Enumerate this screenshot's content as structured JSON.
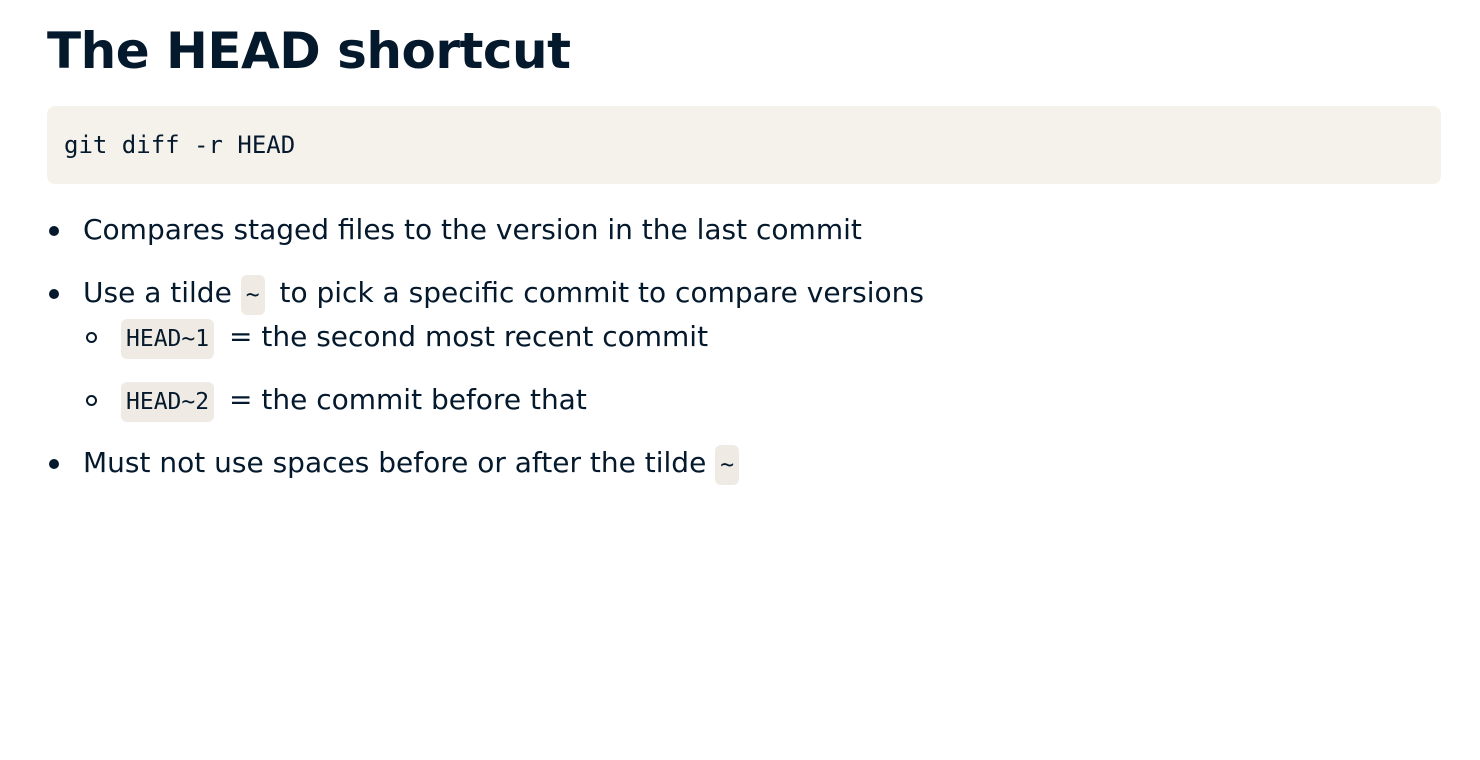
{
  "title": "The HEAD shortcut",
  "command": "git diff -r HEAD",
  "bullets": {
    "b1": "Compares staged files to the version in the last commit",
    "b2_pre": "Use a tilde",
    "b2_code": "~",
    "b2_post": "to pick a specific commit to compare versions",
    "sub1_code": "HEAD~1",
    "sub1_text": "= the second most recent commit",
    "sub2_code": "HEAD~2",
    "sub2_text": "= the commit before that",
    "b3_pre": "Must not use spaces before or after the tilde",
    "b3_code": "~"
  },
  "colors": {
    "text": "#05192d",
    "code_bg": "#f5f2ec",
    "inline_code_bg": "#efebe4"
  }
}
